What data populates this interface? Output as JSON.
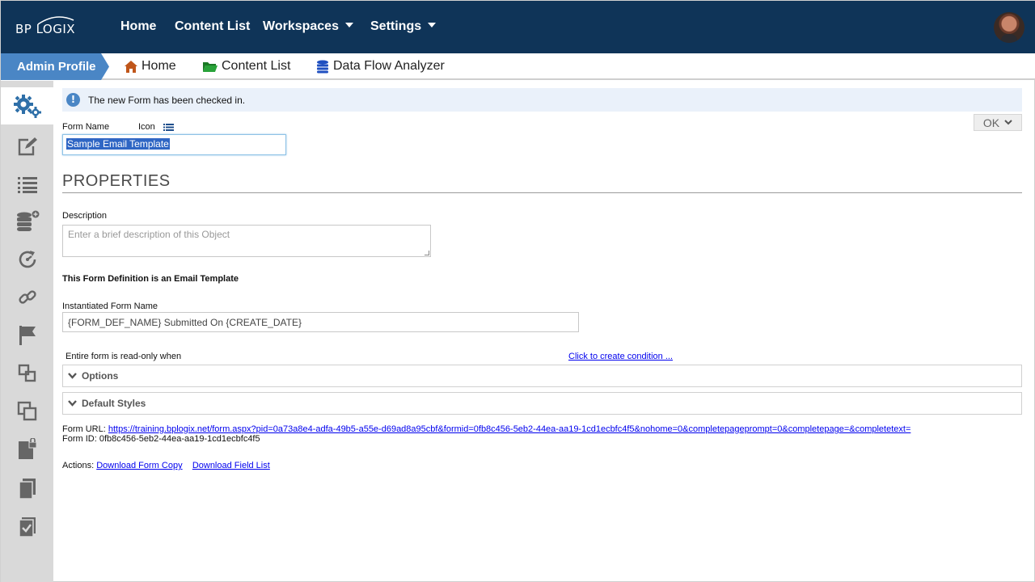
{
  "brand": {
    "logo_text": "BP LOGIX"
  },
  "topnav": {
    "items": [
      {
        "label": "Home"
      },
      {
        "label": "Content List"
      },
      {
        "label": "Workspaces"
      },
      {
        "label": "Settings"
      }
    ]
  },
  "subnav": {
    "profile_label": "Admin Profile",
    "items": [
      {
        "label": "Home",
        "icon": "home-icon",
        "color": "#c0561a"
      },
      {
        "label": "Content List",
        "icon": "folder-icon",
        "color": "#1e8a2a"
      },
      {
        "label": "Data Flow Analyzer",
        "icon": "database-icon",
        "color": "#1f4fc0"
      }
    ]
  },
  "sidebar": {
    "icons": [
      "gears-icon",
      "edit-icon",
      "list-icon",
      "database-add-icon",
      "refresh-gauge-icon",
      "link-icon",
      "flag-icon",
      "copy-shapes-icon",
      "clone-icon",
      "file-lock-icon",
      "pages-icon",
      "checklist-icon"
    ]
  },
  "alert": {
    "text": "The new Form has been checked in."
  },
  "ok_button": {
    "label": "OK"
  },
  "form": {
    "name_label": "Form Name",
    "icon_label": "Icon",
    "name_value": "Sample Email Template"
  },
  "properties": {
    "heading": "PROPERTIES",
    "description_label": "Description",
    "description_placeholder": "Enter a brief description of this Object",
    "email_note": "This Form Definition is an Email Template",
    "instantiated_label": "Instantiated Form Name",
    "instantiated_value": "{FORM_DEF_NAME} Submitted On {CREATE_DATE}",
    "readonly_label": "Entire form is read-only when",
    "condition_link": "Click to create condition ..."
  },
  "sections": [
    {
      "label": "Options"
    },
    {
      "label": "Default Styles"
    }
  ],
  "info": {
    "url_label": "Form URL:",
    "url_value": "https://training.bplogix.net/form.aspx?pid=0a73a8e4-adfa-49b5-a55e-d69ad8a95cbf&formid=0fb8c456-5eb2-44ea-aa19-1cd1ecbfc4f5&nohome=0&completepageprompt=0&completepage=&completetext=",
    "id_label": "Form ID:",
    "id_value": "0fb8c456-5eb2-44ea-aa19-1cd1ecbfc4f5",
    "actions_label": "Actions:",
    "action_download_form": "Download Form Copy",
    "action_download_fields": "Download Field List"
  },
  "colors": {
    "topbar": "#0f3458",
    "accent": "#4a86c5",
    "link": "#0000ee"
  }
}
